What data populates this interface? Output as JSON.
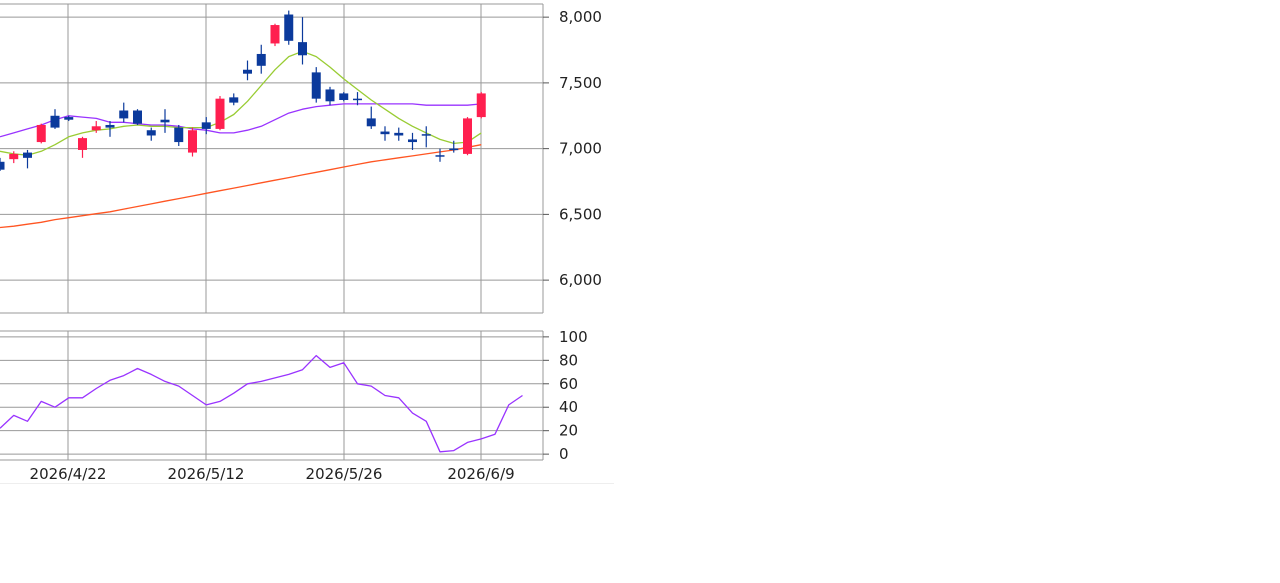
{
  "chart_data": [
    {
      "type": "candlestick",
      "title": "",
      "xlabel": "",
      "ylabel": "",
      "ylim": [
        5750,
        8100
      ],
      "y_ticks": [
        6000,
        6500,
        7000,
        7500,
        8000
      ],
      "y_tick_labels": [
        "6,000",
        "6,500",
        "7,000",
        "7,500",
        "8,000"
      ],
      "x_tick_labels": [
        "2026/4/22",
        "2026/5/12",
        "2026/5/26",
        "2026/6/9"
      ],
      "grid": true,
      "colors": {
        "up": "#ff1f4f",
        "down": "#0b3a9c",
        "ma_short": "#99cc33",
        "ma_mid": "#9933ff",
        "ma_long": "#ff5522",
        "grid": "#999999"
      },
      "candles": [
        {
          "o": 6900,
          "h": 6930,
          "l": 6830,
          "c": 6840
        },
        {
          "o": 6920,
          "h": 6980,
          "l": 6890,
          "c": 6960
        },
        {
          "o": 6970,
          "h": 6990,
          "l": 6850,
          "c": 6930
        },
        {
          "o": 7050,
          "h": 7190,
          "l": 7040,
          "c": 7180
        },
        {
          "o": 7250,
          "h": 7300,
          "l": 7150,
          "c": 7160
        },
        {
          "o": 7240,
          "h": 7250,
          "l": 7210,
          "c": 7220
        },
        {
          "o": 6990,
          "h": 7090,
          "l": 6930,
          "c": 7080
        },
        {
          "o": 7140,
          "h": 7210,
          "l": 7120,
          "c": 7170
        },
        {
          "o": 7180,
          "h": 7210,
          "l": 7090,
          "c": 7160
        },
        {
          "o": 7290,
          "h": 7350,
          "l": 7200,
          "c": 7230
        },
        {
          "o": 7290,
          "h": 7300,
          "l": 7180,
          "c": 7190
        },
        {
          "o": 7140,
          "h": 7160,
          "l": 7060,
          "c": 7100
        },
        {
          "o": 7220,
          "h": 7300,
          "l": 7120,
          "c": 7200
        },
        {
          "o": 7160,
          "h": 7180,
          "l": 7020,
          "c": 7050
        },
        {
          "o": 6970,
          "h": 7160,
          "l": 6940,
          "c": 7140
        },
        {
          "o": 7200,
          "h": 7240,
          "l": 7110,
          "c": 7150
        },
        {
          "o": 7150,
          "h": 7400,
          "l": 7140,
          "c": 7380
        },
        {
          "o": 7390,
          "h": 7420,
          "l": 7330,
          "c": 7350
        },
        {
          "o": 7600,
          "h": 7670,
          "l": 7520,
          "c": 7570
        },
        {
          "o": 7720,
          "h": 7790,
          "l": 7570,
          "c": 7630
        },
        {
          "o": 7800,
          "h": 7950,
          "l": 7780,
          "c": 7940
        },
        {
          "o": 8020,
          "h": 8050,
          "l": 7790,
          "c": 7820
        },
        {
          "o": 7810,
          "h": 8000,
          "l": 7640,
          "c": 7710
        },
        {
          "o": 7580,
          "h": 7620,
          "l": 7350,
          "c": 7380
        },
        {
          "o": 7450,
          "h": 7470,
          "l": 7330,
          "c": 7360
        },
        {
          "o": 7420,
          "h": 7430,
          "l": 7360,
          "c": 7370
        },
        {
          "o": 7380,
          "h": 7430,
          "l": 7330,
          "c": 7370
        },
        {
          "o": 7230,
          "h": 7320,
          "l": 7150,
          "c": 7170
        },
        {
          "o": 7130,
          "h": 7170,
          "l": 7060,
          "c": 7110
        },
        {
          "o": 7120,
          "h": 7160,
          "l": 7060,
          "c": 7100
        },
        {
          "o": 7070,
          "h": 7120,
          "l": 6990,
          "c": 7050
        },
        {
          "o": 7110,
          "h": 7170,
          "l": 7010,
          "c": 7100
        },
        {
          "o": 6950,
          "h": 7000,
          "l": 6900,
          "c": 6940
        },
        {
          "o": 7000,
          "h": 7060,
          "l": 6970,
          "c": 6990
        },
        {
          "o": 6960,
          "h": 7240,
          "l": 6950,
          "c": 7230
        },
        {
          "o": 7240,
          "h": 7430,
          "l": 7230,
          "c": 7420
        }
      ],
      "ma_short": [
        6980,
        6960,
        6950,
        6980,
        7030,
        7090,
        7120,
        7140,
        7150,
        7170,
        7180,
        7170,
        7170,
        7160,
        7160,
        7160,
        7200,
        7260,
        7360,
        7480,
        7600,
        7700,
        7740,
        7700,
        7620,
        7530,
        7450,
        7370,
        7300,
        7230,
        7170,
        7120,
        7070,
        7040,
        7050,
        7120
      ],
      "ma_mid": [
        7090,
        7120,
        7150,
        7180,
        7220,
        7250,
        7240,
        7230,
        7200,
        7200,
        7190,
        7180,
        7180,
        7170,
        7150,
        7140,
        7120,
        7120,
        7140,
        7170,
        7220,
        7270,
        7300,
        7320,
        7330,
        7340,
        7340,
        7340,
        7340,
        7340,
        7340,
        7330,
        7330,
        7330,
        7330,
        7340
      ],
      "ma_long": [
        6400,
        6410,
        6425,
        6440,
        6460,
        6475,
        6490,
        6505,
        6520,
        6540,
        6560,
        6580,
        6600,
        6620,
        6640,
        6660,
        6680,
        6700,
        6720,
        6740,
        6760,
        6780,
        6800,
        6820,
        6840,
        6860,
        6880,
        6900,
        6915,
        6930,
        6945,
        6960,
        6975,
        6990,
        7010,
        7030
      ]
    },
    {
      "type": "line",
      "title": "",
      "xlabel": "",
      "ylabel": "",
      "ylim": [
        -5,
        105
      ],
      "y_ticks": [
        0,
        20,
        40,
        60,
        80,
        100
      ],
      "y_tick_labels": [
        "0",
        "20",
        "40",
        "60",
        "80",
        "100"
      ],
      "grid": true,
      "series": [
        {
          "color": "#9933ff",
          "values": [
            22,
            33,
            28,
            45,
            40,
            48,
            48,
            56,
            63,
            67,
            73,
            68,
            62,
            58,
            50,
            42,
            45,
            52,
            60,
            62,
            65,
            68,
            72,
            84,
            74,
            78,
            60,
            58,
            50,
            48,
            35,
            28,
            2,
            3,
            10,
            13,
            17,
            42,
            50
          ]
        }
      ]
    }
  ]
}
